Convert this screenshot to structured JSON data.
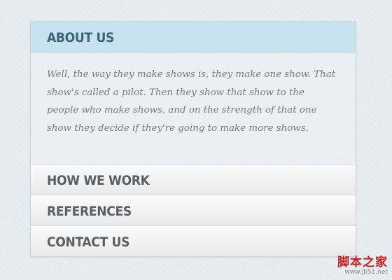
{
  "accordion": {
    "sections": [
      {
        "title": "ABOUT US",
        "expanded": true,
        "body": "Well, the way they make shows is, they make one show. That show's called a pilot. Then they show that show to the people who make shows, and on the strength of that one show they decide if they're going to make more shows."
      },
      {
        "title": "HOW WE WORK",
        "expanded": false
      },
      {
        "title": "REFERENCES",
        "expanded": false
      },
      {
        "title": "CONTACT US",
        "expanded": false
      }
    ]
  },
  "watermark": {
    "title": "脚本之家",
    "url": "www.jb51.net"
  },
  "colors": {
    "active_header_bg": "#c8e1ee",
    "active_header_text": "#3a6478",
    "closed_header_text": "#5b5f63",
    "body_text": "#747c82",
    "watermark_red": "#d21d1d"
  }
}
